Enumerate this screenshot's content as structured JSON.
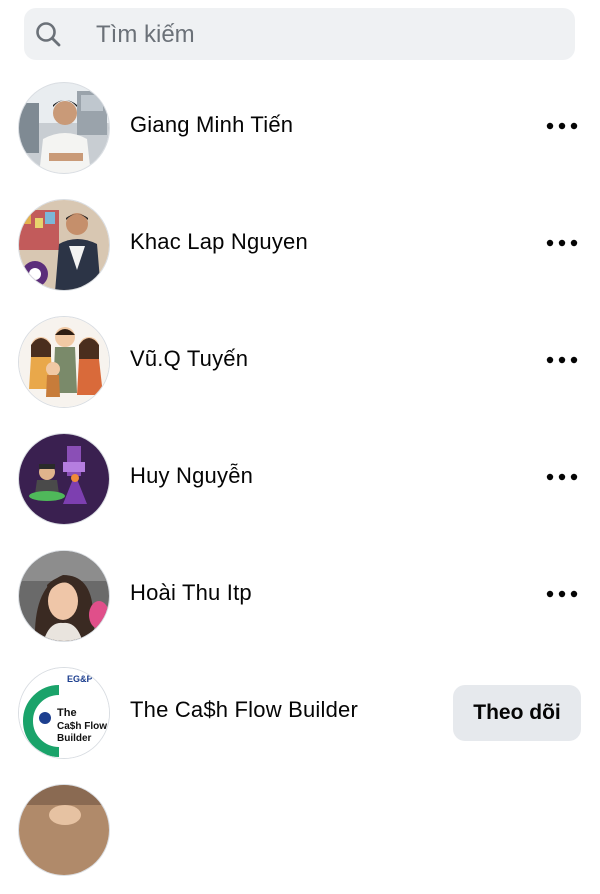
{
  "search": {
    "placeholder": "Tìm kiếm"
  },
  "icons": {
    "search": "search-icon",
    "more": "more-options-icon"
  },
  "colors": {
    "search_bg": "#eff1f3",
    "button_bg": "#e6e9ed",
    "text": "#050505",
    "placeholder": "#6b7178"
  },
  "people": [
    {
      "name": "Giang Minh Tiến",
      "action": "more"
    },
    {
      "name": "Khac Lap Nguyen",
      "action": "more"
    },
    {
      "name": "Vũ.Q Tuyến",
      "action": "more"
    },
    {
      "name": "Huy Nguyễn",
      "action": "more"
    },
    {
      "name": "Hoài Thu Itp",
      "action": "more"
    },
    {
      "name": "The Ca$h Flow Builder",
      "action": "follow",
      "follow_label": "Theo dõi",
      "logo_text": {
        "top": "EG&P",
        "line1": "The",
        "line2": "Ca$h Flow",
        "line3": "Builder"
      }
    }
  ]
}
